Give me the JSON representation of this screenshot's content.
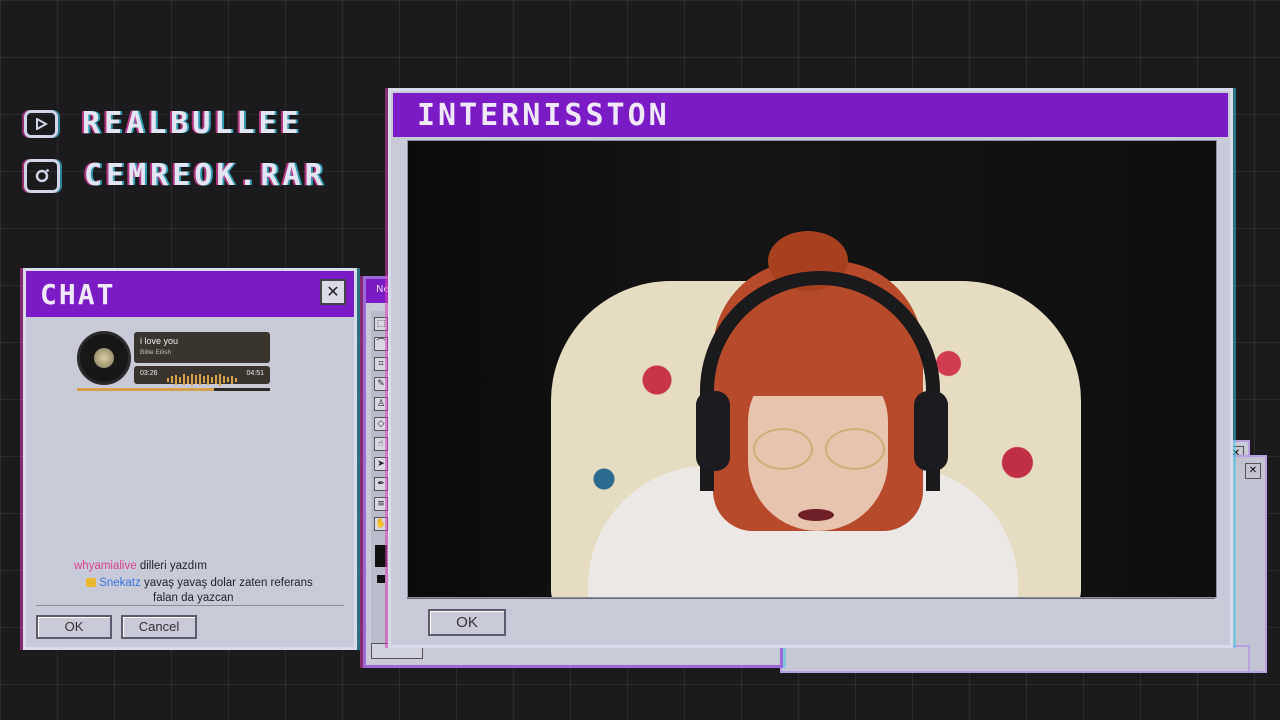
{
  "socials": [
    {
      "icon": "youtube-icon",
      "handle": "REALBULLEE"
    },
    {
      "icon": "instagram-icon",
      "handle": "CEMREOK.RAR"
    }
  ],
  "chat_window": {
    "title": "CHAT",
    "close_symbol": "✕",
    "music": {
      "song": "i love you",
      "artist": "Billie Eilish",
      "current_time": "03:26",
      "total_time": "04:51",
      "progress": 0.71
    },
    "messages": [
      {
        "user": "whyamialive",
        "text": "dilleri yazdım",
        "user_color": "#d8458c"
      },
      {
        "user": "Snekatz",
        "text": "yavaş yavaş dolar zaten referans",
        "text2": "falan da yazcan",
        "user_color": "#3a74e0",
        "badge": "crown-badge-icon"
      }
    ],
    "ok_label": "OK",
    "cancel_label": "Cancel"
  },
  "paint_window": {
    "title_fragment": "Ne"
  },
  "main_window": {
    "title": "INTERNISSTON",
    "ok_label": "OK"
  },
  "colors": {
    "accent": "#7b1bc6",
    "window": "#c8cad8",
    "background": "#1b1b1d"
  }
}
